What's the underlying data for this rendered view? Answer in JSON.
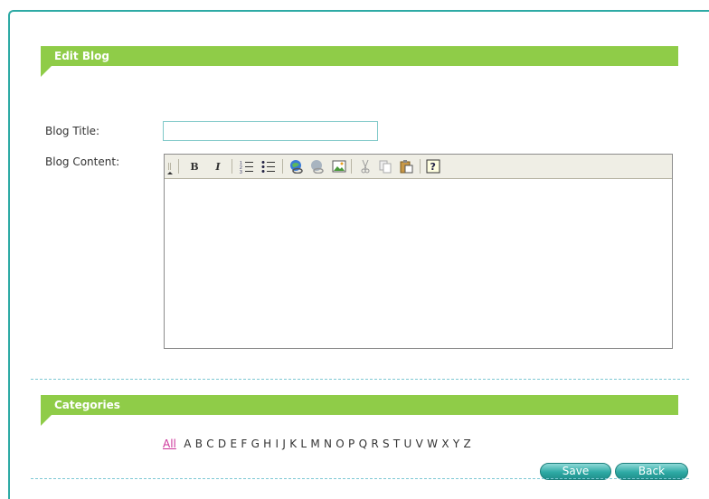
{
  "edit_section": {
    "title": "Edit Blog"
  },
  "form": {
    "blog_title_label": "Blog Title:",
    "blog_title_value": "",
    "blog_content_label": "Blog Content:",
    "blog_content_value": ""
  },
  "editor_toolbar": {
    "items": [
      "collapse-toolbar-icon",
      "bold-icon",
      "italic-icon",
      "ordered-list-icon",
      "unordered-list-icon",
      "insert-link-icon",
      "remove-link-icon",
      "insert-image-icon",
      "cut-icon",
      "copy-icon",
      "paste-icon",
      "help-icon"
    ]
  },
  "categories_section": {
    "title": "Categories"
  },
  "alphabet": {
    "all": "All",
    "letters": [
      "A",
      "B",
      "C",
      "D",
      "E",
      "F",
      "G",
      "H",
      "I",
      "J",
      "K",
      "L",
      "M",
      "N",
      "O",
      "P",
      "Q",
      "R",
      "S",
      "T",
      "U",
      "V",
      "W",
      "X",
      "Y",
      "Z"
    ]
  },
  "actions": {
    "save_label": "Save",
    "back_label": "Back"
  },
  "colors": {
    "accent_green": "#8fcc48",
    "teal": "#2eaaa5",
    "link_pink": "#cc3399"
  }
}
